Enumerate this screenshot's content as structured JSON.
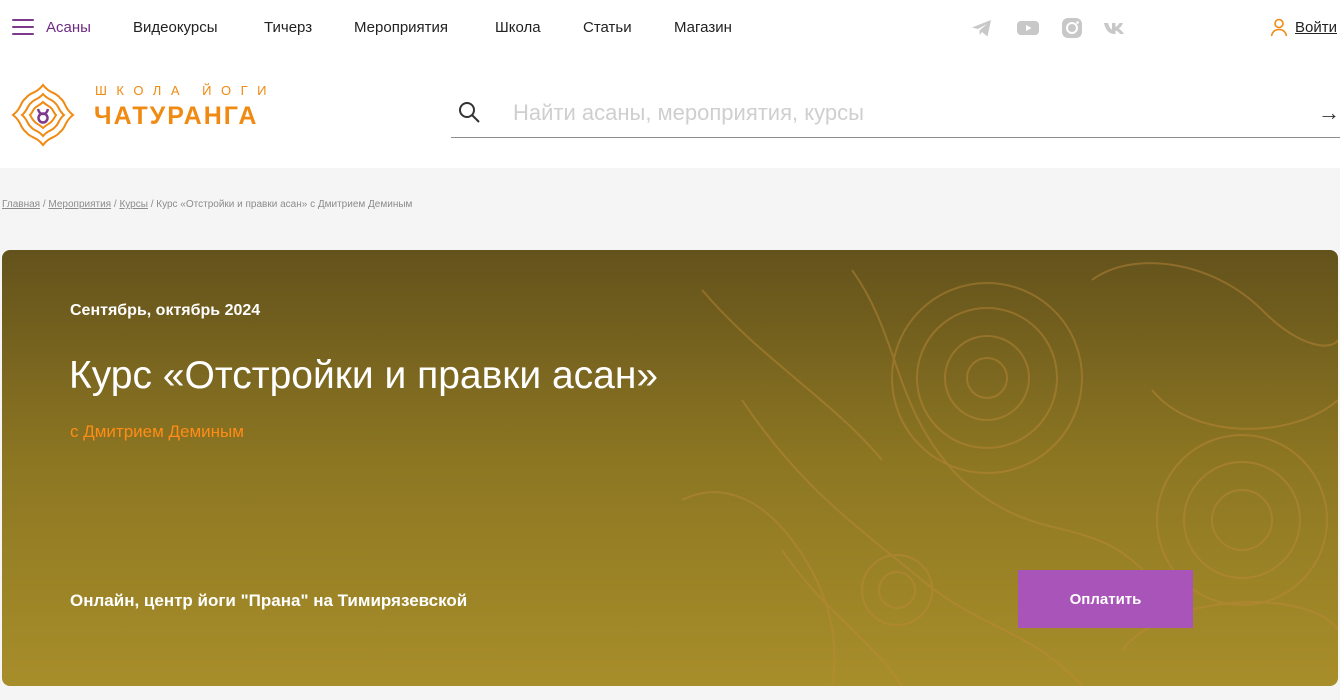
{
  "topnav": {
    "items": [
      {
        "label": "Асаны"
      },
      {
        "label": "Видеокурсы"
      },
      {
        "label": "Тичерз"
      },
      {
        "label": "Мероприятия"
      },
      {
        "label": "Школа"
      },
      {
        "label": "Статьи"
      },
      {
        "label": "Магазин"
      }
    ],
    "social_icons": [
      "telegram-icon",
      "youtube-icon",
      "instagram-icon",
      "vk-icon"
    ],
    "login_label": "Войти"
  },
  "logo": {
    "small": "ШКОЛА ЙОГИ",
    "big": "ЧАТУРАНГА"
  },
  "search": {
    "placeholder": "Найти асаны, мероприятия, курсы",
    "value": ""
  },
  "breadcrumb": {
    "items": [
      "Главная",
      "Мероприятия",
      "Курсы"
    ],
    "current": "Курс «Отстройки и правки асан» с Дмитрием Деминым"
  },
  "hero": {
    "date": "Сентябрь, октябрь 2024",
    "title": "Курс «Отстройки и правки асан»",
    "teacher": "с Дмитрием Деминым",
    "location": "Онлайн, центр йоги \"Прана\" на Тимирязевской",
    "button": "Оплатить"
  },
  "colors": {
    "brand_purple": "#7d3a8c",
    "brand_orange": "#f08a12",
    "button": "#a854b8"
  }
}
